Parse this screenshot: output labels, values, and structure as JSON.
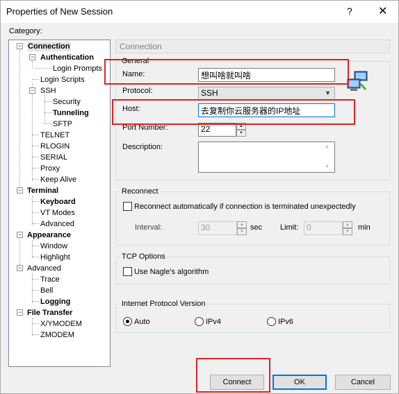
{
  "window": {
    "title": "Properties of New Session",
    "help": "?",
    "close": "✕"
  },
  "category_label": "Category:",
  "tree": {
    "connection": "Connection",
    "authentication": "Authentication",
    "login_prompts": "Login Prompts",
    "login_scripts": "Login Scripts",
    "ssh": "SSH",
    "security": "Security",
    "tunneling": "Tunneling",
    "sftp": "SFTP",
    "telnet": "TELNET",
    "rlogin": "RLOGIN",
    "serial": "SERIAL",
    "proxy": "Proxy",
    "keep_alive": "Keep Alive",
    "terminal": "Terminal",
    "keyboard": "Keyboard",
    "vt_modes": "VT Modes",
    "advanced": "Advanced",
    "appearance": "Appearance",
    "window": "Window",
    "highlight": "Highlight",
    "advanced2": "Advanced",
    "trace": "Trace",
    "bell": "Bell",
    "logging": "Logging",
    "file_transfer": "File Transfer",
    "xymodem": "X/YMODEM",
    "zmodem": "ZMODEM"
  },
  "panel_header": "Connection",
  "general": {
    "title": "General",
    "name_label": "Name:",
    "name_value": "想叫啥就叫啥",
    "protocol_label": "Protocol:",
    "protocol_value": "SSH",
    "host_label": "Host:",
    "host_value": "去复制你云服务器的IP地址",
    "port_label": "Port Number:",
    "port_value": "22",
    "description_label": "Description:"
  },
  "reconnect": {
    "title": "Reconnect",
    "auto_label": "Reconnect automatically if connection is terminated unexpectedly",
    "interval_label": "Interval:",
    "interval_value": "30",
    "sec_label": "sec",
    "limit_label": "Limit:",
    "limit_value": "0",
    "min_label": "min"
  },
  "tcp": {
    "title": "TCP Options",
    "nagle_label": "Use Nagle's algorithm"
  },
  "ip_version": {
    "title": "Internet Protocol Version",
    "auto": "Auto",
    "ipv4": "IPv4",
    "ipv6": "IPv6",
    "selected": "Auto"
  },
  "buttons": {
    "connect": "Connect",
    "ok": "OK",
    "cancel": "Cancel"
  },
  "colors": {
    "annotation_red": "#e02020",
    "focus_blue": "#0078d7"
  }
}
